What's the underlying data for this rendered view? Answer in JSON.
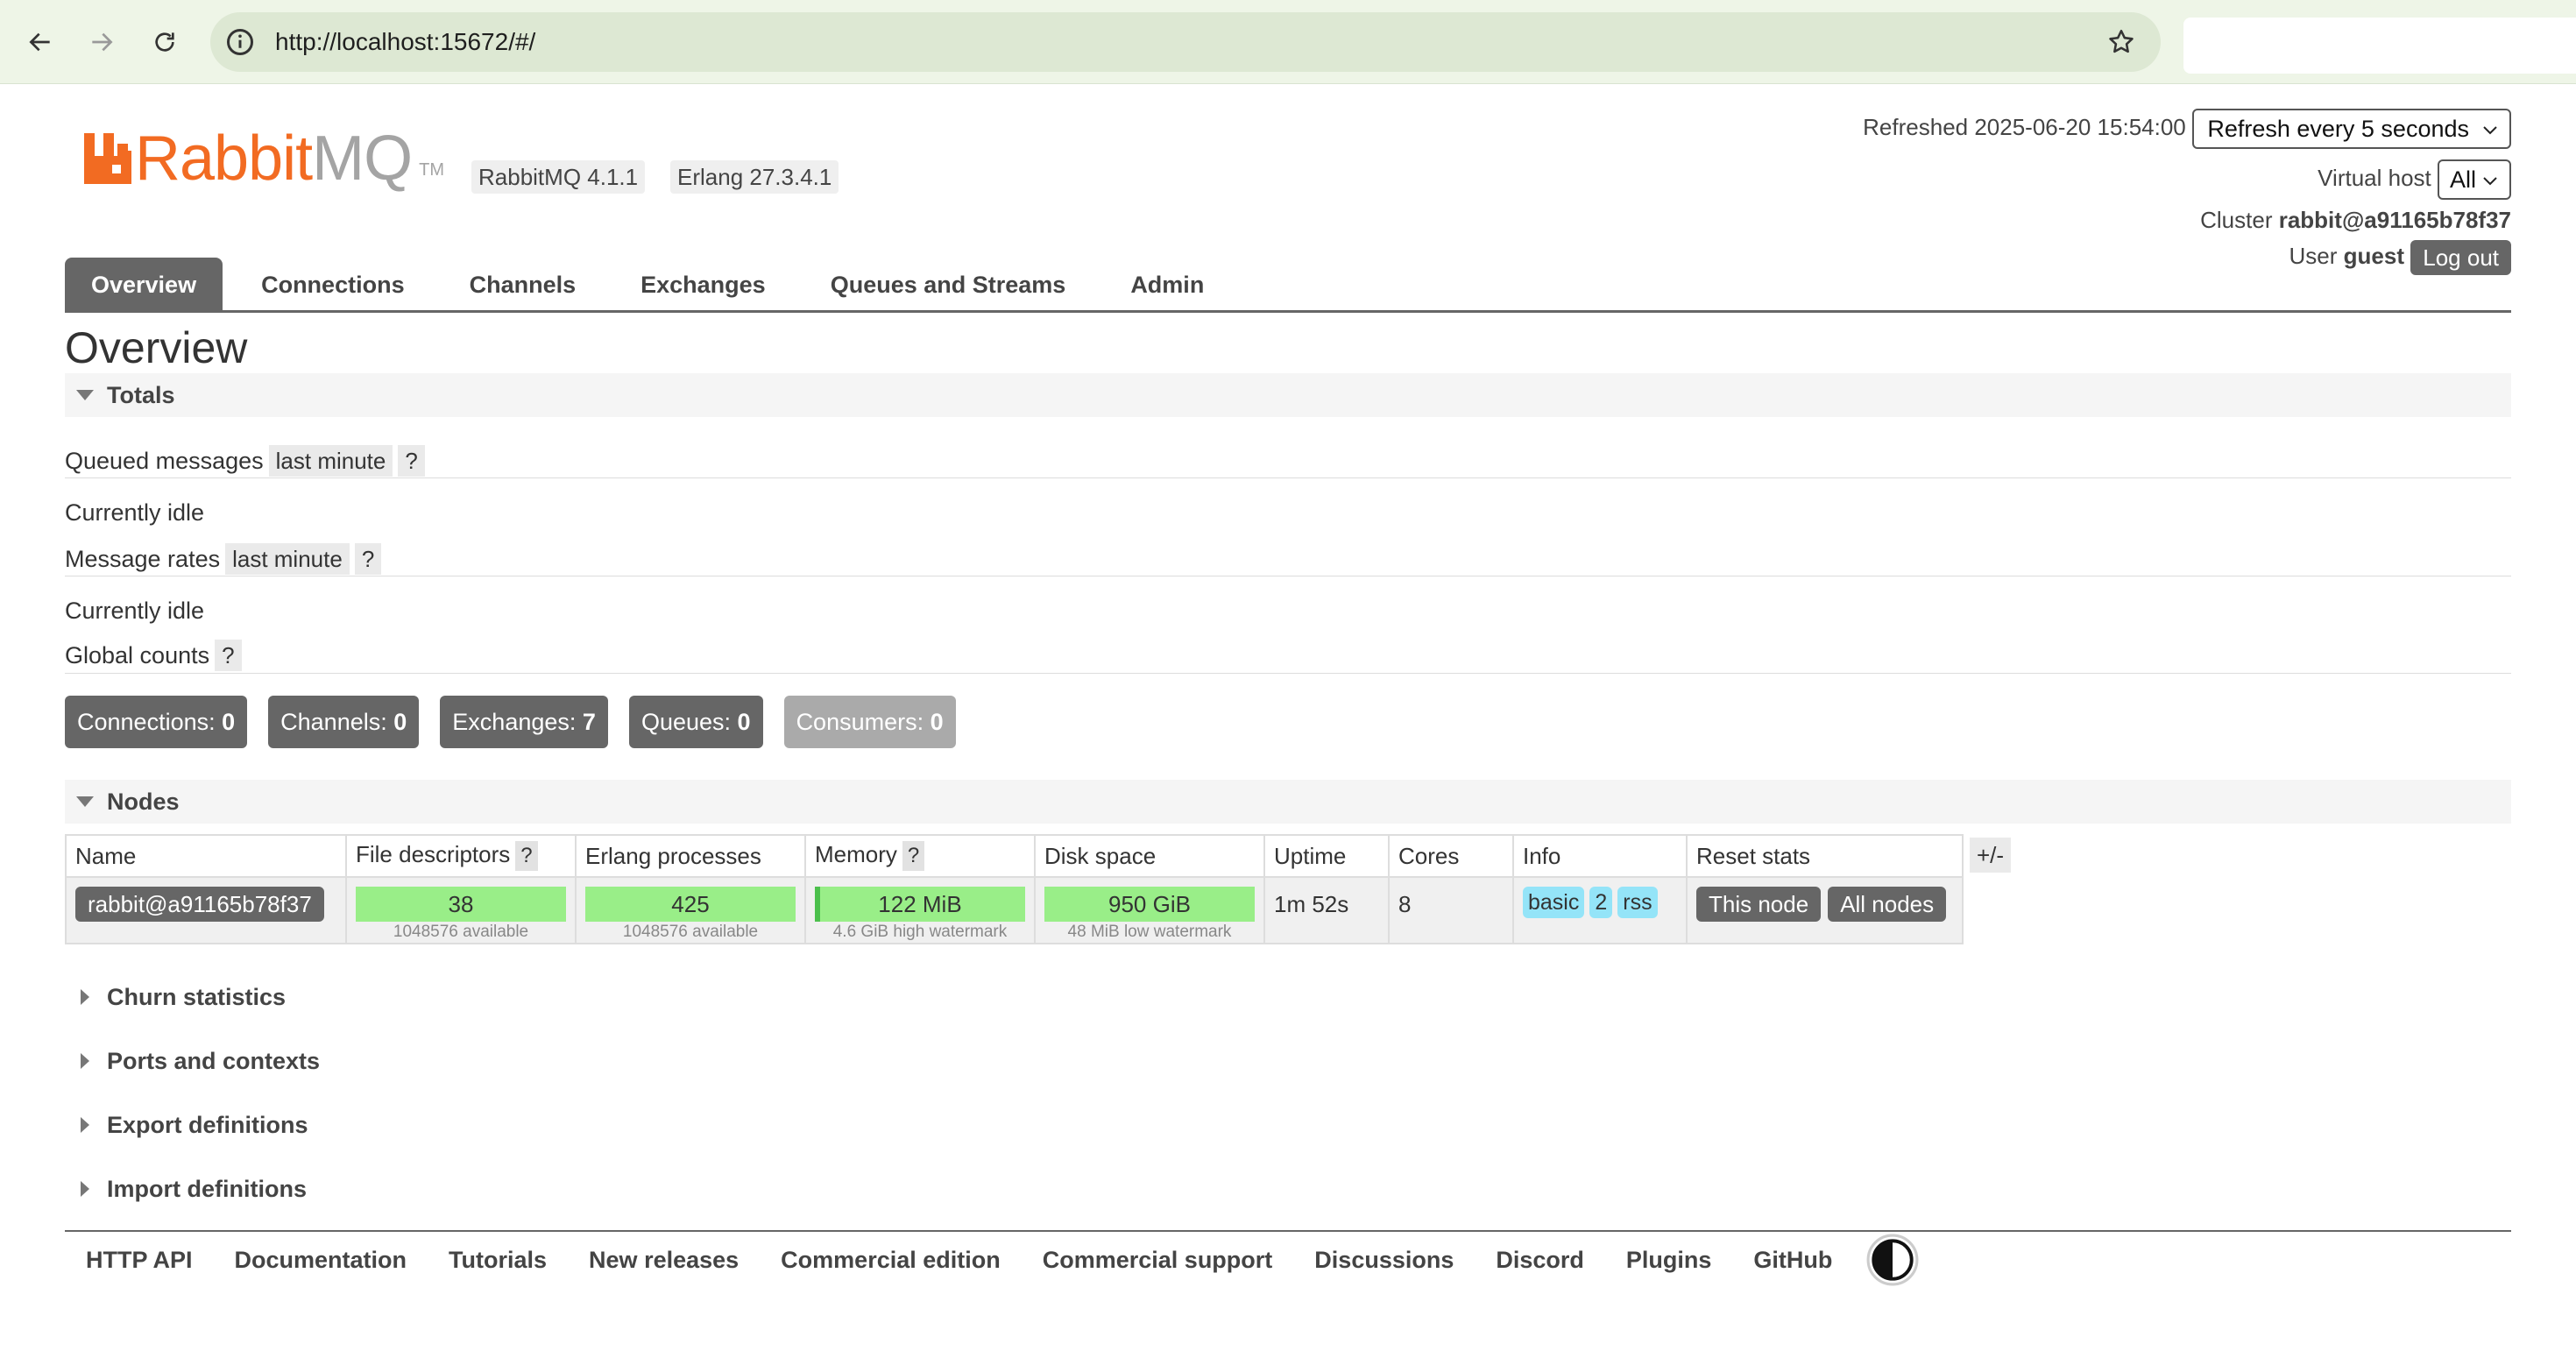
{
  "browser": {
    "url": "http://localhost:15672/#/"
  },
  "header": {
    "logo_rabbit": "Rabbit",
    "logo_mq": "MQ",
    "logo_tm": "TM",
    "rabbitmq_version": "RabbitMQ 4.1.1",
    "erlang_version": "Erlang 27.3.4.1",
    "refreshed_label": "Refreshed 2025-06-20 15:54:00",
    "refresh_select": "Refresh every 5 seconds",
    "vhost_label": "Virtual host",
    "vhost_select": "All",
    "cluster_label": "Cluster",
    "cluster_name": "rabbit@a91165b78f37",
    "user_label": "User",
    "user_name": "guest",
    "logout_label": "Log out"
  },
  "tabs": [
    {
      "label": "Overview",
      "active": true
    },
    {
      "label": "Connections"
    },
    {
      "label": "Channels"
    },
    {
      "label": "Exchanges"
    },
    {
      "label": "Queues and Streams"
    },
    {
      "label": "Admin"
    }
  ],
  "page_title": "Overview",
  "totals": {
    "title": "Totals",
    "queued_messages_label": "Queued messages",
    "queued_range": "last minute",
    "help": "?",
    "queued_status": "Currently idle",
    "message_rates_label": "Message rates",
    "rates_range": "last minute",
    "rates_status": "Currently idle",
    "global_counts_label": "Global counts",
    "counts": [
      {
        "label": "Connections:",
        "value": "0"
      },
      {
        "label": "Channels:",
        "value": "0"
      },
      {
        "label": "Exchanges:",
        "value": "7"
      },
      {
        "label": "Queues:",
        "value": "0"
      },
      {
        "label": "Consumers:",
        "value": "0"
      }
    ]
  },
  "nodes": {
    "title": "Nodes",
    "columns": [
      "Name",
      "File descriptors",
      "Erlang processes",
      "Memory",
      "Disk space",
      "Uptime",
      "Cores",
      "Info",
      "Reset stats"
    ],
    "plus_minus": "+/-",
    "row": {
      "name": "rabbit@a91165b78f37",
      "fd_value": "38",
      "fd_sub": "1048576 available",
      "proc_value": "425",
      "proc_sub": "1048576 available",
      "mem_value": "122 MiB",
      "mem_sub": "4.6 GiB high watermark",
      "mem_fraction": 0.026,
      "disk_value": "950 GiB",
      "disk_sub": "48 MiB low watermark",
      "uptime": "1m 52s",
      "cores": "8",
      "info_tags": [
        "basic",
        "2",
        "rss"
      ],
      "reset_this": "This node",
      "reset_all": "All nodes"
    }
  },
  "collapsed_sections": [
    "Churn statistics",
    "Ports and contexts",
    "Export definitions",
    "Import definitions"
  ],
  "footer_links": [
    "HTTP API",
    "Documentation",
    "Tutorials",
    "New releases",
    "Commercial edition",
    "Commercial support",
    "Discussions",
    "Discord",
    "Plugins",
    "GitHub"
  ],
  "colors": {
    "brand_orange": "#f26b22",
    "tab_active": "#666666",
    "bar_green": "#99ee88",
    "info_tag": "#94e4f8"
  }
}
